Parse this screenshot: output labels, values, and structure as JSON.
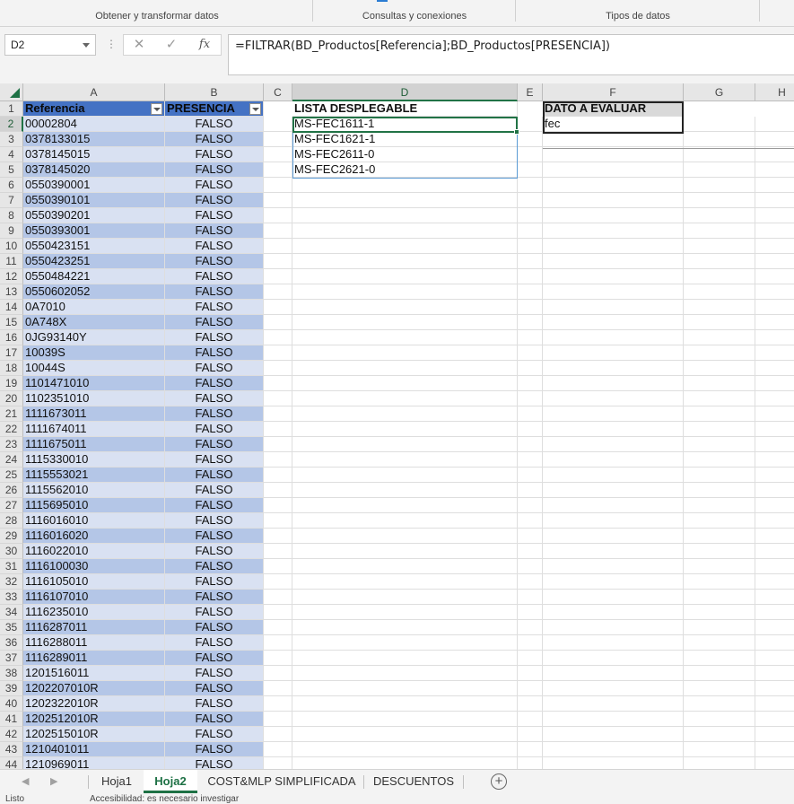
{
  "ribbon": {
    "groups": [
      "Obtener y transformar datos",
      "Consultas y conexiones",
      "Tipos de datos"
    ]
  },
  "formula_bar": {
    "name_box": "D2",
    "more_icon": "⋮",
    "cancel_icon": "✕",
    "enter_icon": "✓",
    "fx_label": "fx",
    "formula": "=FILTRAR(BD_Productos[Referencia];BD_Productos[PRESENCIA])"
  },
  "columns": [
    "A",
    "B",
    "C",
    "D",
    "E",
    "F",
    "G",
    "H"
  ],
  "row_numbers": [
    "1",
    "2",
    "3",
    "4",
    "5",
    "6",
    "7",
    "8",
    "9",
    "10",
    "11",
    "12",
    "13",
    "14",
    "15",
    "16",
    "17",
    "18",
    "19",
    "20",
    "21",
    "22",
    "23",
    "24",
    "25",
    "26",
    "27",
    "28",
    "29",
    "30",
    "31",
    "32",
    "33",
    "34",
    "35",
    "36",
    "37",
    "38",
    "39",
    "40",
    "41",
    "42",
    "43",
    "44"
  ],
  "table": {
    "header_referencia": "Referencia",
    "header_presencia": "PRESENCIA",
    "referencias": [
      "00002804",
      "0378133015",
      "0378145015",
      "0378145020",
      "0550390001",
      "0550390101",
      "0550390201",
      "0550393001",
      "0550423151",
      "0550423251",
      "0550484221",
      "0550602052",
      "0A7010",
      "0A748X",
      "0JG93140Y",
      "10039S",
      "10044S",
      "1101471010",
      "1102351010",
      "1111673011",
      "1111674011",
      "1111675011",
      "1115330010",
      "1115553021",
      "1115562010",
      "1115695010",
      "1116016010",
      "1116016020",
      "1116022010",
      "1116100030",
      "1116105010",
      "1116107010",
      "1116235010",
      "1116287011",
      "1116288011",
      "1116289011",
      "1201516011",
      "1202207010R",
      "1202322010R",
      "1202512010R",
      "1202515010R",
      "1210401011",
      "1210969011"
    ],
    "presencia_value": "FALSO"
  },
  "lista": {
    "header": "LISTA DESPLEGABLE",
    "items": [
      "MS-FEC1611-1",
      "MS-FEC1621-1",
      "MS-FEC2611-0",
      "MS-FEC2621-0"
    ]
  },
  "dato": {
    "header": "DATO A EVALUAR",
    "value": "fec"
  },
  "sheet_tabs": {
    "prev_icon": "◀",
    "next_icon": "▶",
    "tabs": [
      "Hoja1",
      "Hoja2",
      "COST&MLP SIMPLIFICADA",
      "DESCUENTOS"
    ],
    "active": "Hoja2",
    "add_icon": "+"
  },
  "status": {
    "ready": "Listo",
    "accessibility": "Accesibilidad: es necesario investigar"
  }
}
